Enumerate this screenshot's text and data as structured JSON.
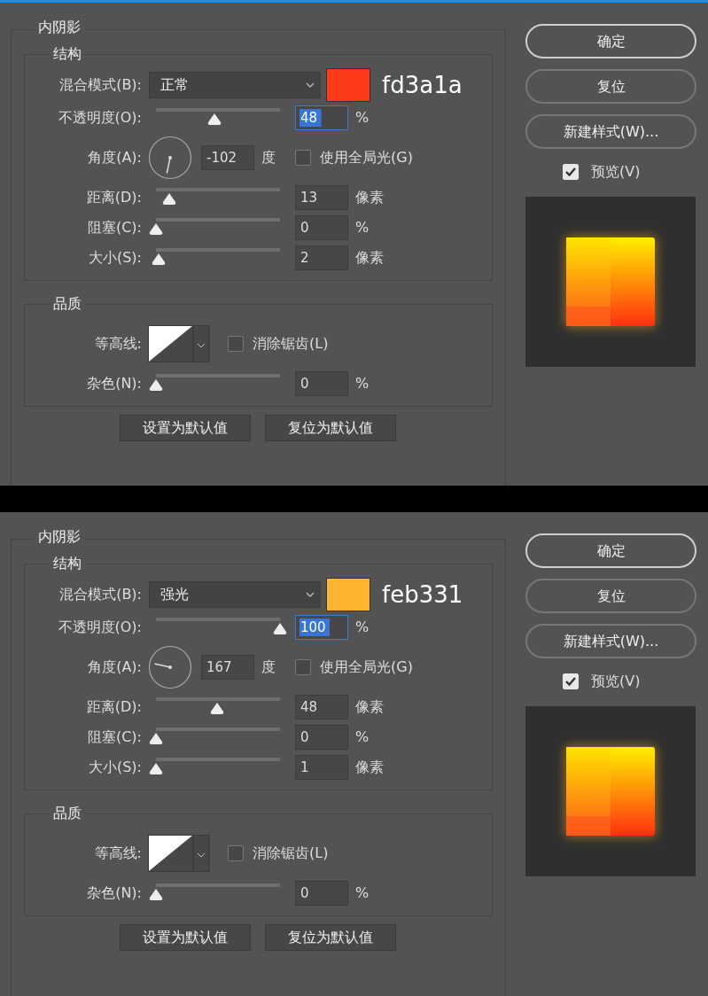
{
  "panels": [
    {
      "section_title": "内阴影",
      "structure": {
        "title": "结构",
        "rows": [
          {
            "kind": "blend",
            "label": "混合模式(B):",
            "value": "正常",
            "color": "#fd3a1a",
            "note": "fd3a1a"
          },
          {
            "kind": "slider",
            "label": "不透明度(O):",
            "level": 0.47,
            "value": "48",
            "unit": "%",
            "highlighted": true
          },
          {
            "kind": "angle",
            "label": "角度(A):",
            "value": "-102",
            "unit": "度",
            "option": {
              "label": "使用全局光(G)",
              "checked": false
            }
          },
          {
            "kind": "slider",
            "label": "距离(D):",
            "level": 0.11,
            "value": "13",
            "unit": "像素",
            "highlighted": false
          },
          {
            "kind": "slider",
            "label": "阻塞(C):",
            "level": 0,
            "value": "0",
            "unit": "%",
            "highlighted": false
          },
          {
            "kind": "slider",
            "label": "大小(S):",
            "level": 0.02,
            "value": "2",
            "unit": "像素",
            "highlighted": false
          }
        ]
      },
      "quality": {
        "title": "品质",
        "contour": {
          "label": "等高线:"
        },
        "anti_alias": {
          "label": "消除锯齿(L)",
          "checked": false
        },
        "noise": {
          "label": "杂色(N):",
          "level": 0,
          "value": "0",
          "unit": "%",
          "highlighted": false
        }
      },
      "buttons": [
        "设置为默认值",
        "复位为默认值"
      ],
      "side_buttons": [
        {
          "label": "确定",
          "kind": "default"
        },
        {
          "label": "复位",
          "kind": "normal"
        },
        {
          "label": "新建样式(W)...",
          "kind": "normal"
        }
      ],
      "preview": {
        "label": "预览(V)",
        "checked": true
      }
    },
    {
      "section_title": "内阴影",
      "structure": {
        "title": "结构",
        "rows": [
          {
            "kind": "blend",
            "label": "混合模式(B):",
            "value": "强光",
            "color": "#feb331",
            "note": "feb331"
          },
          {
            "kind": "slider",
            "label": "不透明度(O):",
            "level": 1,
            "value": "100",
            "unit": "%",
            "highlighted": true
          },
          {
            "kind": "angle",
            "label": "角度(A):",
            "value": "167",
            "unit": "度",
            "option": {
              "label": "使用全局光(G)",
              "checked": false
            }
          },
          {
            "kind": "slider",
            "label": "距离(D):",
            "level": 0.49,
            "value": "48",
            "unit": "像素",
            "highlighted": false
          },
          {
            "kind": "slider",
            "label": "阻塞(C):",
            "level": 0,
            "value": "0",
            "unit": "%",
            "highlighted": false
          },
          {
            "kind": "slider",
            "label": "大小(S):",
            "level": 0,
            "value": "1",
            "unit": "像素",
            "highlighted": false
          }
        ]
      },
      "quality": {
        "title": "品质",
        "contour": {
          "label": "等高线:"
        },
        "anti_alias": {
          "label": "消除锯齿(L)",
          "checked": false
        },
        "noise": {
          "label": "杂色(N):",
          "level": 0,
          "value": "0",
          "unit": "%",
          "highlighted": false
        }
      },
      "buttons": [
        "设置为默认值",
        "复位为默认值"
      ],
      "side_buttons": [
        {
          "label": "确定",
          "kind": "default"
        },
        {
          "label": "复位",
          "kind": "normal"
        },
        {
          "label": "新建样式(W)...",
          "kind": "normal"
        }
      ],
      "preview": {
        "label": "预览(V)",
        "checked": true
      }
    }
  ]
}
